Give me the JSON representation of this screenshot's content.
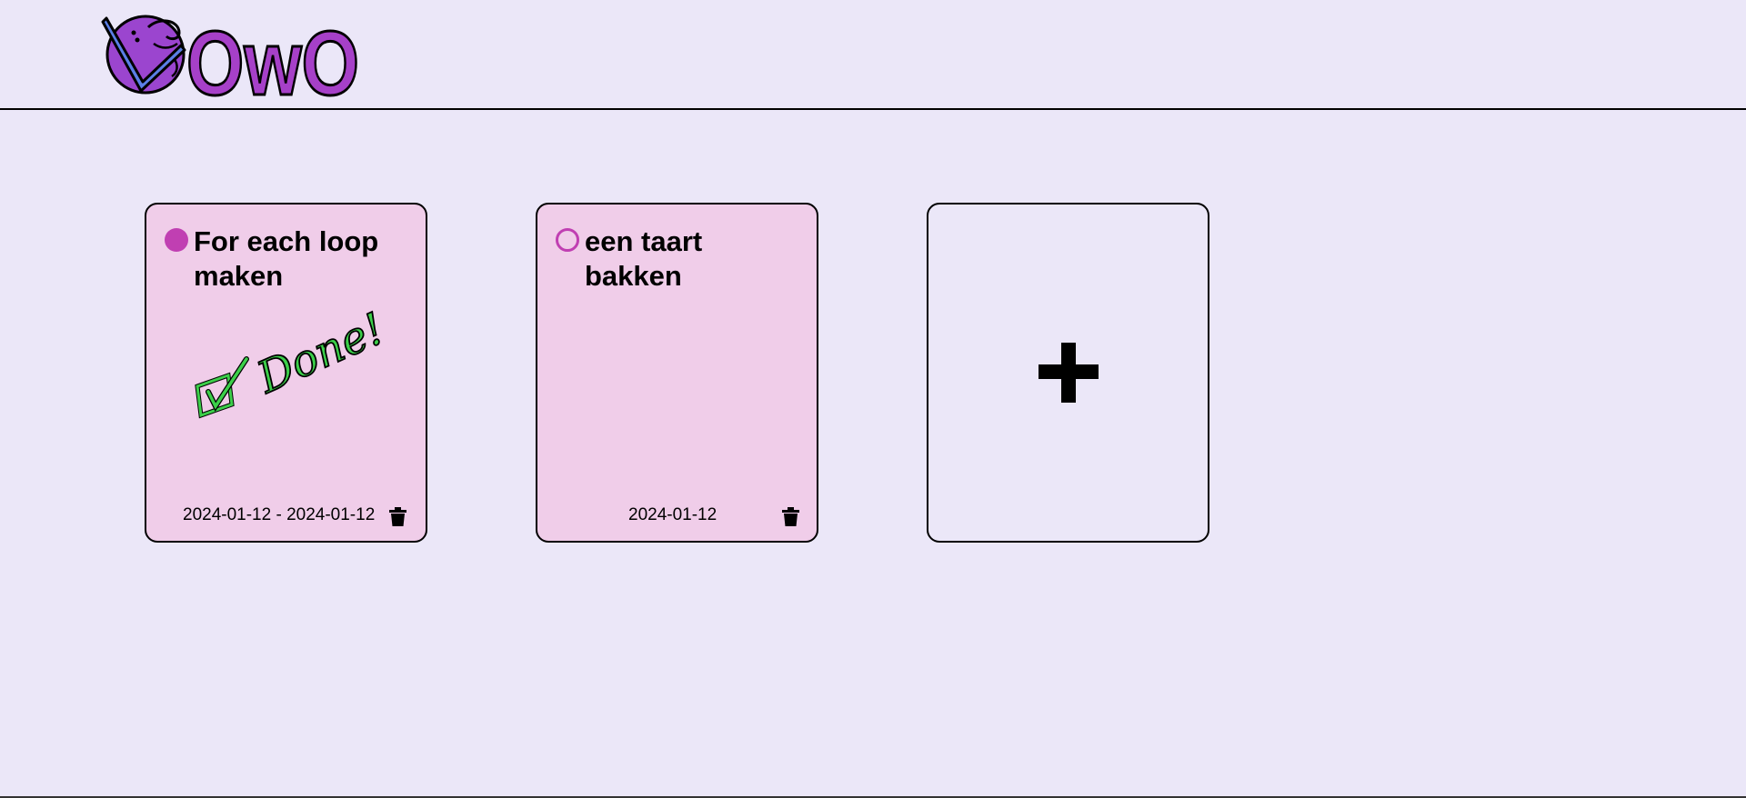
{
  "app": {
    "logo_text": "OwO",
    "logo_icon": "checkmark-circle-logo"
  },
  "colors": {
    "background": "#ebe7f8",
    "card": "#f0cde9",
    "accent": "#c03fb2",
    "done_stamp": "#3ccf4a"
  },
  "tasks": [
    {
      "title": "For each loop maken",
      "status": "done",
      "status_icon": "filled-circle-icon",
      "stamp": "Done!",
      "date": "2024-01-12 - 2024-01-12",
      "delete_icon": "trash-icon"
    },
    {
      "title": "een taart bakken",
      "status": "todo",
      "status_icon": "empty-circle-icon",
      "date": "2024-01-12",
      "delete_icon": "trash-icon"
    }
  ],
  "add_card": {
    "icon": "plus-icon"
  }
}
